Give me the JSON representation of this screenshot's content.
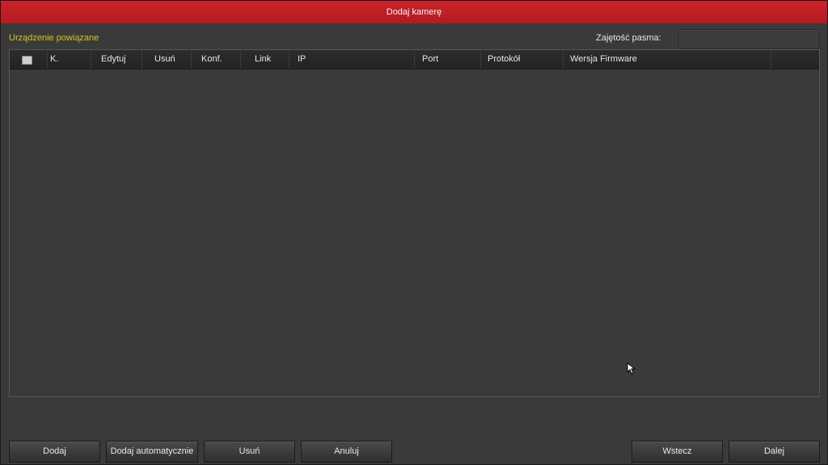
{
  "window": {
    "title": "Dodaj kamerę"
  },
  "section": {
    "label": "Urządzenie powiązane"
  },
  "bandwidth": {
    "label": "Zajętość pasma:",
    "value": ""
  },
  "table": {
    "columns": [
      "K.",
      "Edytuj",
      "Usuń",
      "Konf.",
      "Link",
      "IP",
      "Port",
      "Protokół",
      "Wersja Firmware",
      ""
    ],
    "rows": []
  },
  "buttons": {
    "add": "Dodaj",
    "auto_add": "Dodaj automatycznie",
    "delete": "Usuń",
    "cancel": "Anuluj",
    "back": "Wstecz",
    "next": "Dalej"
  },
  "colors": {
    "title_bar": "#c41f26",
    "section_label": "#d8c420",
    "background": "#3a3a3a"
  }
}
